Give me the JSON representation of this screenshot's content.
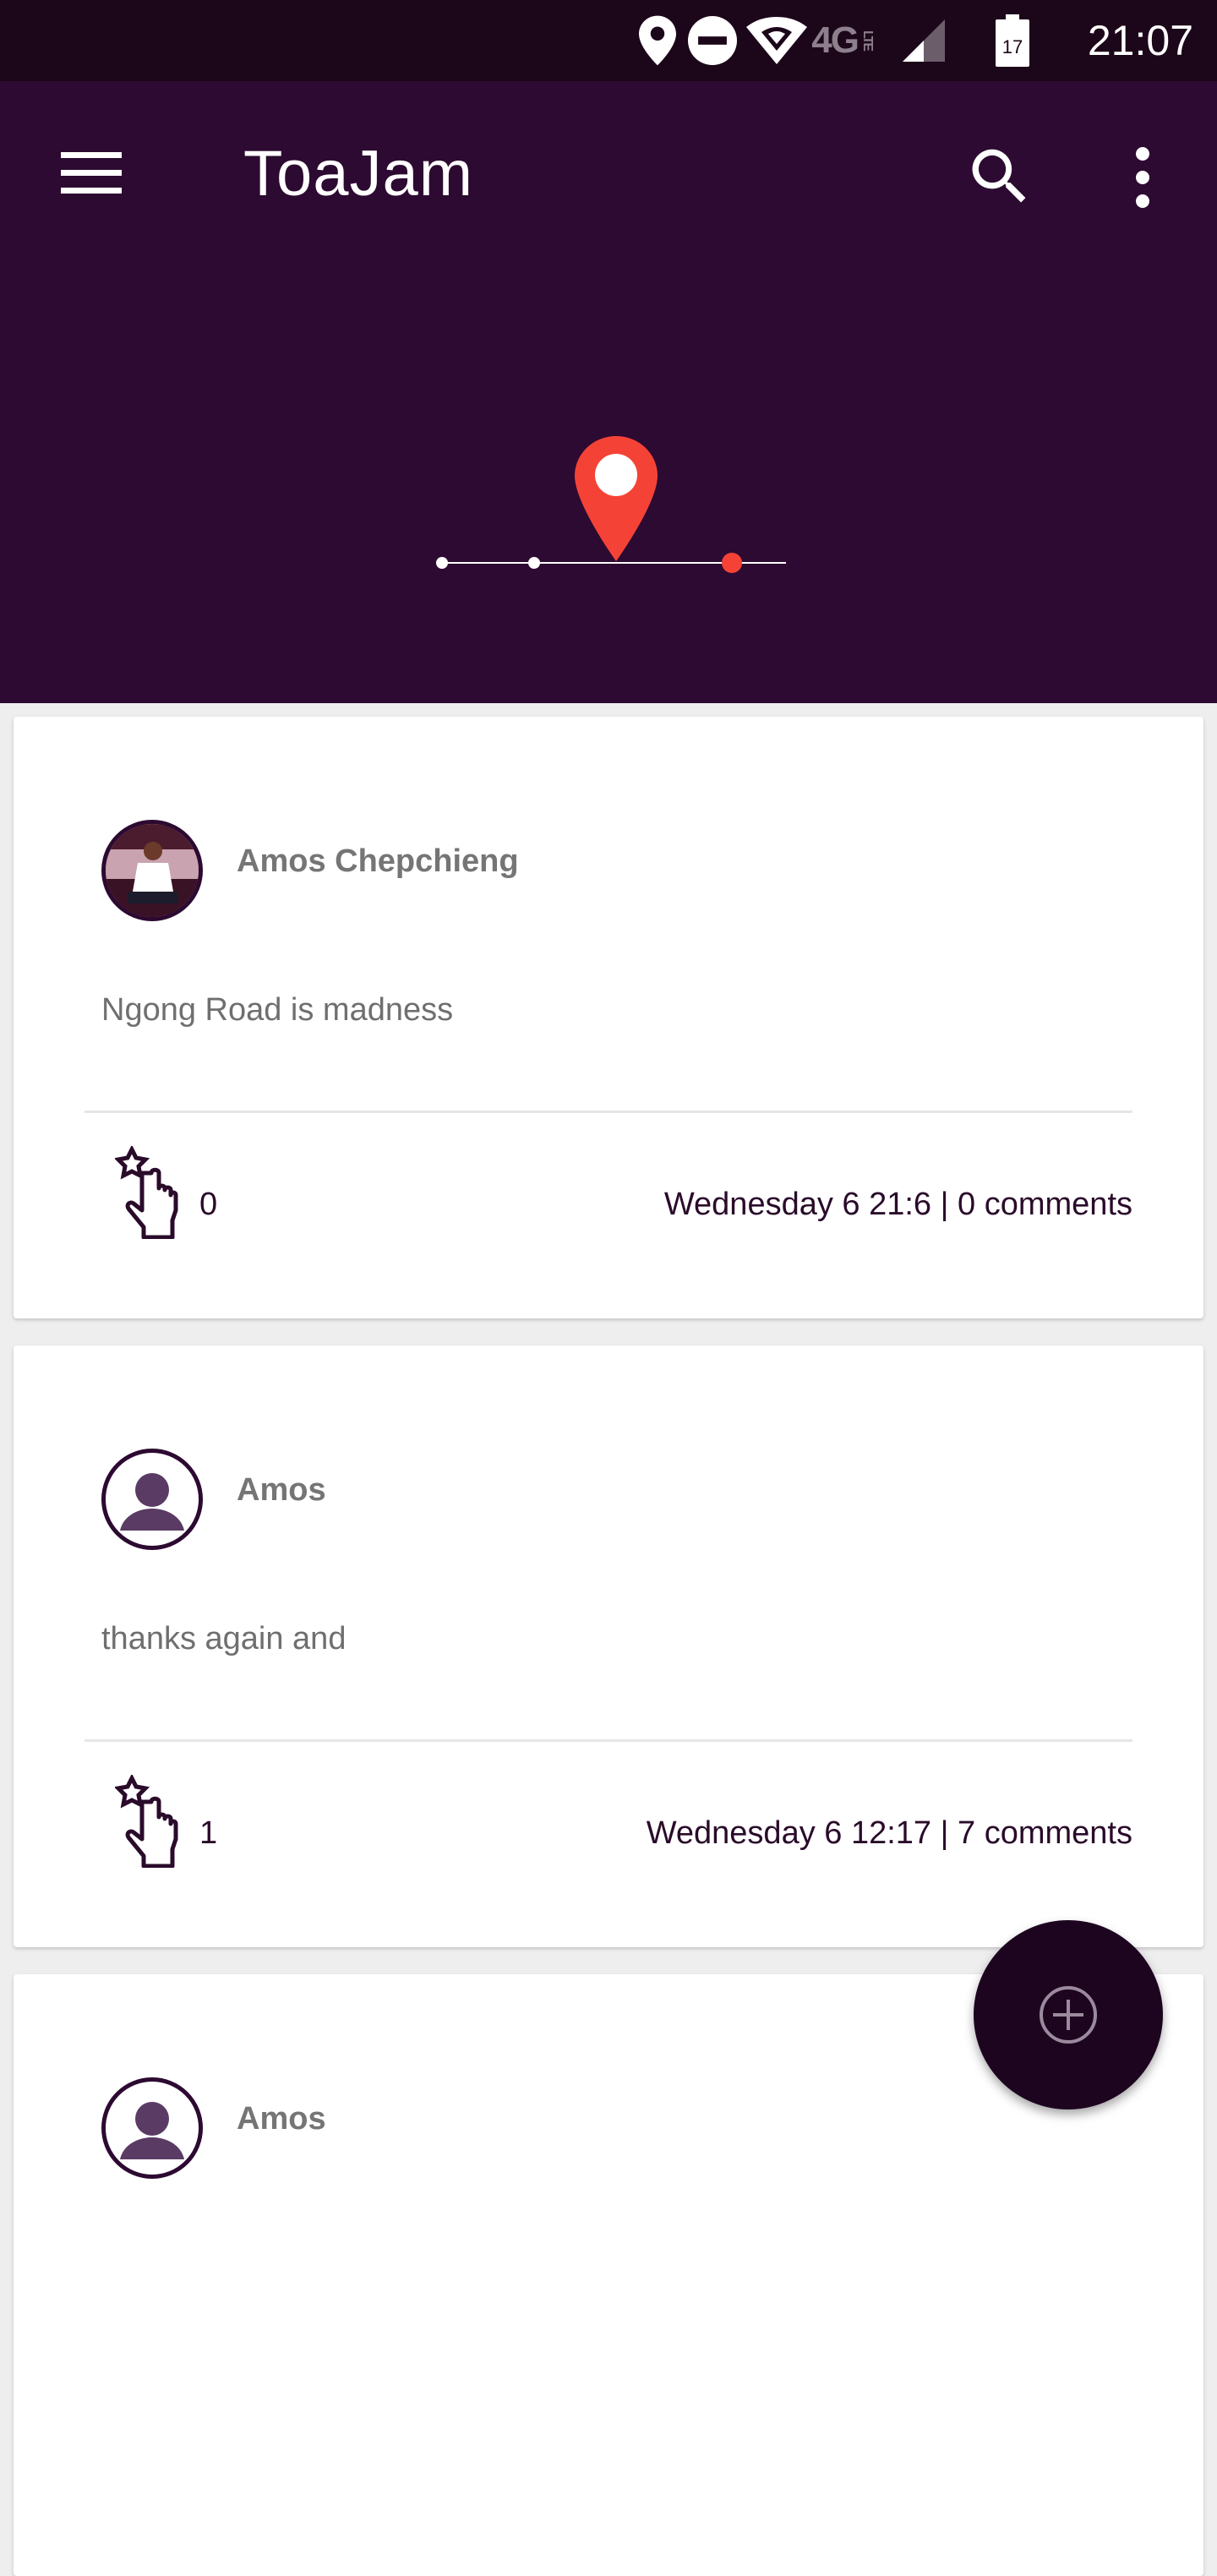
{
  "status_bar": {
    "time": "21:07",
    "network_label": "4G",
    "battery_level": "17",
    "icons": [
      "location-icon",
      "do-not-disturb-icon",
      "wifi-icon",
      "lte-icon",
      "signal-icon",
      "battery-icon"
    ]
  },
  "app_bar": {
    "title": "ToaJam",
    "icons": [
      "menu-icon",
      "search-icon",
      "more-vert-icon"
    ]
  },
  "hero": {
    "icon": "map-pin-icon",
    "accent_color": "#f44336",
    "background_color": "#2d0a31"
  },
  "posts": [
    {
      "author": "Amos Chepchieng",
      "avatar": "photo",
      "text": "Ngong Road is madness",
      "likes": "0",
      "meta": "Wednesday 6  21:6 | 0 comments"
    },
    {
      "author": "Amos",
      "avatar": "default-person-icon",
      "text": "thanks again and",
      "likes": "1",
      "meta": "Wednesday 6  12:17 | 7 comments"
    },
    {
      "author": "Amos",
      "avatar": "default-person-icon",
      "text": "",
      "likes": "",
      "meta": ""
    }
  ],
  "fab": {
    "icon": "add-circle-outline-icon"
  }
}
